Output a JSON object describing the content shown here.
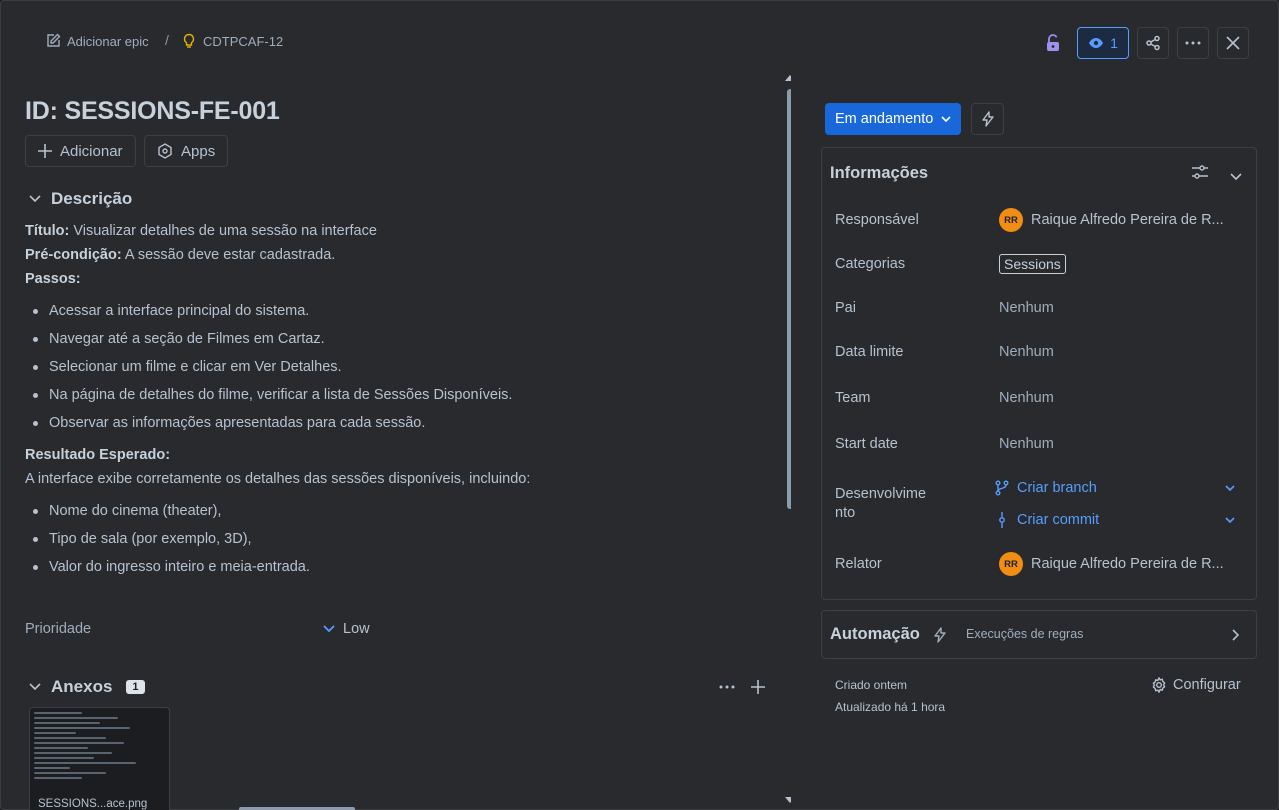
{
  "header": {
    "add_epic_label": "Adicionar epic",
    "separator": "/",
    "issue_key": "CDTPCAF-12",
    "watch_count": "1"
  },
  "issue": {
    "title": "ID: SESSIONS-FE-001",
    "add_label": "Adicionar",
    "apps_label": "Apps"
  },
  "description": {
    "heading": "Descrição",
    "title_label": "Título:",
    "title_text": " Visualizar detalhes de uma sessão na interface",
    "precondition_label": "Pré-condição:",
    "precondition_text": " A sessão deve estar cadastrada.",
    "steps_label": "Passos:",
    "steps": [
      "Acessar a interface principal do sistema.",
      "Navegar até a seção de Filmes em Cartaz.",
      "Selecionar um filme e clicar em Ver Detalhes.",
      "Na página de detalhes do filme, verificar a lista de Sessões Disponíveis.",
      "Observar as informações apresentadas para cada sessão."
    ],
    "expected_label": "Resultado Esperado:",
    "expected_text": "A interface exibe corretamente os detalhes das sessões disponíveis, incluindo:",
    "expected_items": [
      "Nome do cinema (theater),",
      "Tipo de sala (por exemplo, 3D),",
      "Valor do ingresso inteiro e meia-entrada."
    ]
  },
  "priority": {
    "label": "Prioridade",
    "value": "Low"
  },
  "attachments": {
    "heading": "Anexos",
    "count": "1",
    "file_name": "SESSIONS...ace.png"
  },
  "status": {
    "label": "Em andamento"
  },
  "info": {
    "heading": "Informações",
    "rows": {
      "assignee_label": "Responsável",
      "assignee_initials": "RR",
      "assignee_name": "Raique Alfredo Pereira de R...",
      "categories_label": "Categorias",
      "categories_value": "Sessions",
      "parent_label": "Pai",
      "parent_value": "Nenhum",
      "due_label": "Data limite",
      "due_value": "Nenhum",
      "team_label": "Team",
      "team_value": "Nenhum",
      "start_label": "Start date",
      "start_value": "Nenhum",
      "dev_label_1": "Desenvolvime",
      "dev_label_2": "nto",
      "create_branch": "Criar branch",
      "create_commit": "Criar commit",
      "reporter_label": "Relator",
      "reporter_initials": "RR",
      "reporter_name": "Raique Alfredo Pereira de R..."
    }
  },
  "automation": {
    "heading": "Automação",
    "rule_runs": "Execuções de regras"
  },
  "footer": {
    "created": "Criado ontem",
    "updated": "Atualizado há 1 hora",
    "configure": "Configurar"
  },
  "colors": {
    "background": "#282a2e",
    "accent": "#1868db",
    "link": "#579dff",
    "avatar": "#f18d13"
  }
}
